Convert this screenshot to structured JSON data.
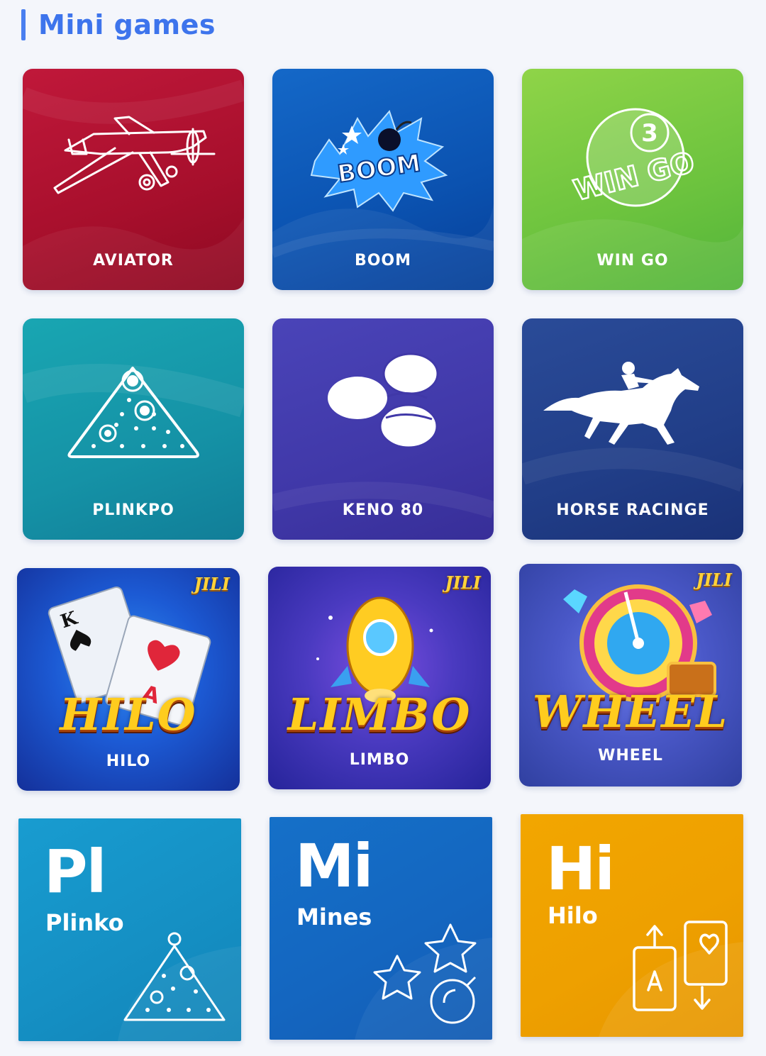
{
  "section": {
    "title": "Mini games"
  },
  "games_row1": [
    {
      "label": "AVIATOR"
    },
    {
      "label": "BOOM",
      "art_text": "BOOM"
    },
    {
      "label": "WIN GO",
      "art_text": "WIN GO",
      "ball_number": "3"
    }
  ],
  "games_row2": [
    {
      "label": "PLINKPO"
    },
    {
      "label": "KENO 80"
    },
    {
      "label": "HORSE RACINGE"
    }
  ],
  "games_row3": [
    {
      "label": "HILO",
      "brand": "HILO",
      "provider": "JILI"
    },
    {
      "label": "LIMBO",
      "brand": "LIMBO",
      "provider": "JILI"
    },
    {
      "label": "WHEEL",
      "brand": "WHEEL",
      "provider": "JILI"
    }
  ],
  "games_row4": [
    {
      "abbr": "Pl",
      "name": "Plinko",
      "color": "#1596c8"
    },
    {
      "abbr": "Mi",
      "name": "Mines",
      "color": "#1565c0"
    },
    {
      "abbr": "Hi",
      "name": "Hilo",
      "color": "#f0a000"
    }
  ]
}
